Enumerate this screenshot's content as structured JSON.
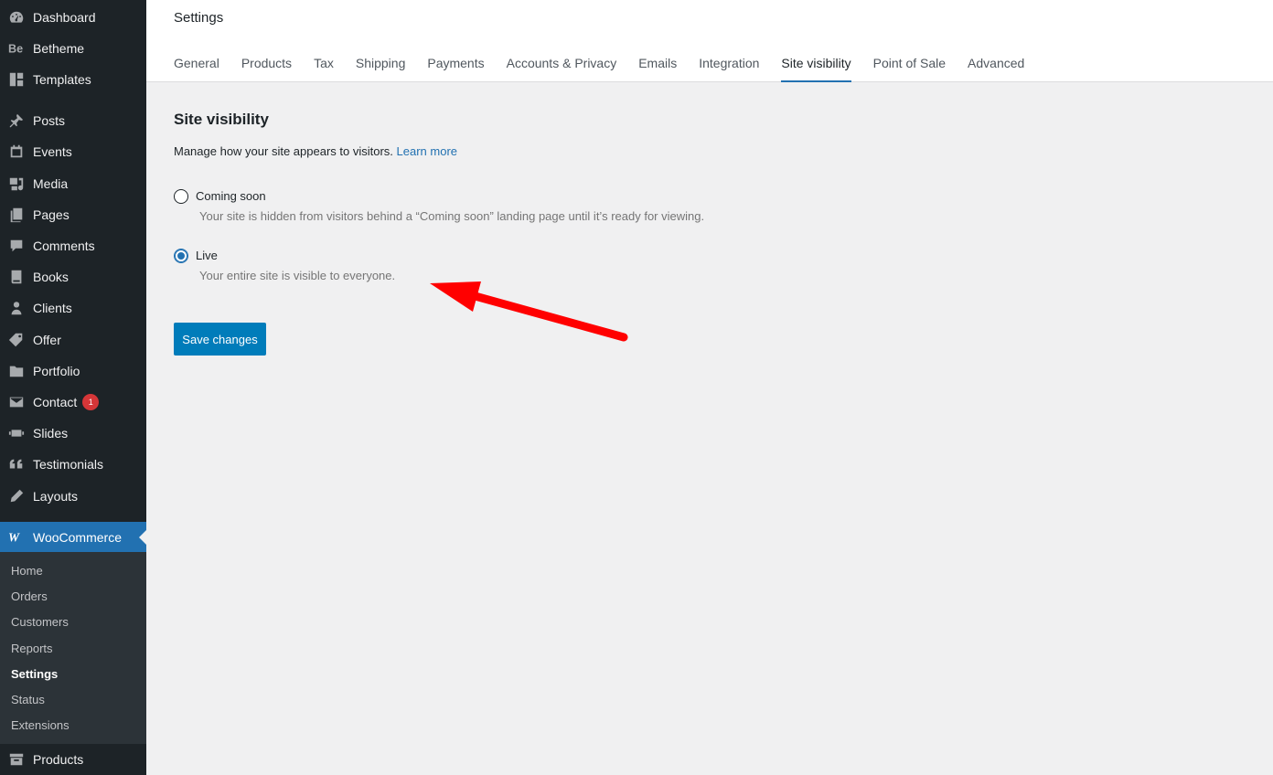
{
  "sidebar": {
    "items": [
      {
        "label": "Dashboard",
        "icon": "dashboard-icon"
      },
      {
        "label": "Betheme",
        "icon": "betheme-icon"
      },
      {
        "label": "Templates",
        "icon": "templates-icon"
      },
      {
        "label": "Posts",
        "icon": "pin-icon"
      },
      {
        "label": "Events",
        "icon": "calendar-icon"
      },
      {
        "label": "Media",
        "icon": "media-icon"
      },
      {
        "label": "Pages",
        "icon": "pages-icon"
      },
      {
        "label": "Comments",
        "icon": "comment-icon"
      },
      {
        "label": "Books",
        "icon": "book-icon"
      },
      {
        "label": "Clients",
        "icon": "user-icon"
      },
      {
        "label": "Offer",
        "icon": "tag-icon"
      },
      {
        "label": "Portfolio",
        "icon": "folder-icon"
      },
      {
        "label": "Contact",
        "icon": "mail-icon",
        "badge": "1"
      },
      {
        "label": "Slides",
        "icon": "slides-icon"
      },
      {
        "label": "Testimonials",
        "icon": "quote-icon"
      },
      {
        "label": "Layouts",
        "icon": "pencil-icon"
      },
      {
        "label": "WooCommerce",
        "icon": "woo-icon"
      },
      {
        "label": "Products",
        "icon": "archive-icon"
      }
    ],
    "woocommerce_submenu": [
      "Home",
      "Orders",
      "Customers",
      "Reports",
      "Settings",
      "Status",
      "Extensions"
    ],
    "current_submenu": "Settings"
  },
  "header": {
    "title": "Settings",
    "tabs": [
      "General",
      "Products",
      "Tax",
      "Shipping",
      "Payments",
      "Accounts & Privacy",
      "Emails",
      "Integration",
      "Site visibility",
      "Point of Sale",
      "Advanced"
    ],
    "active_tab": "Site visibility"
  },
  "main": {
    "section_title": "Site visibility",
    "description": "Manage how your site appears to visitors.",
    "learn_more": "Learn more",
    "options": [
      {
        "label": "Coming soon",
        "help": "Your site is hidden from visitors behind a “Coming soon” landing page until it’s ready for viewing.",
        "checked": false
      },
      {
        "label": "Live",
        "help": "Your entire site is visible to everyone.",
        "checked": true
      }
    ],
    "save_label": "Save changes"
  },
  "colors": {
    "accent": "#2271b1",
    "button": "#007cba",
    "sidebar_bg": "#1d2327",
    "annotation_arrow": "#ff0000"
  }
}
